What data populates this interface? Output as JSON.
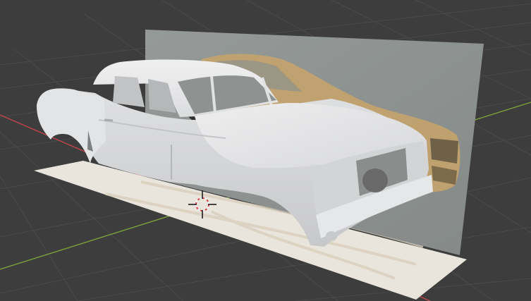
{
  "viewport": {
    "editor": "3d-viewport",
    "background_color": "#3d3d3d",
    "grid_color": "#4a4a4a",
    "axis_x_color": "#c4444f",
    "axis_y_color": "#7aa03a",
    "reference_plane_color": "#8d918f",
    "floor_plane_color": "#e9e5dc",
    "car_body_color": "#d9dadb",
    "reference_car_color": "#c8a56a",
    "icons": {
      "origin": "3d-cursor-icon"
    }
  }
}
